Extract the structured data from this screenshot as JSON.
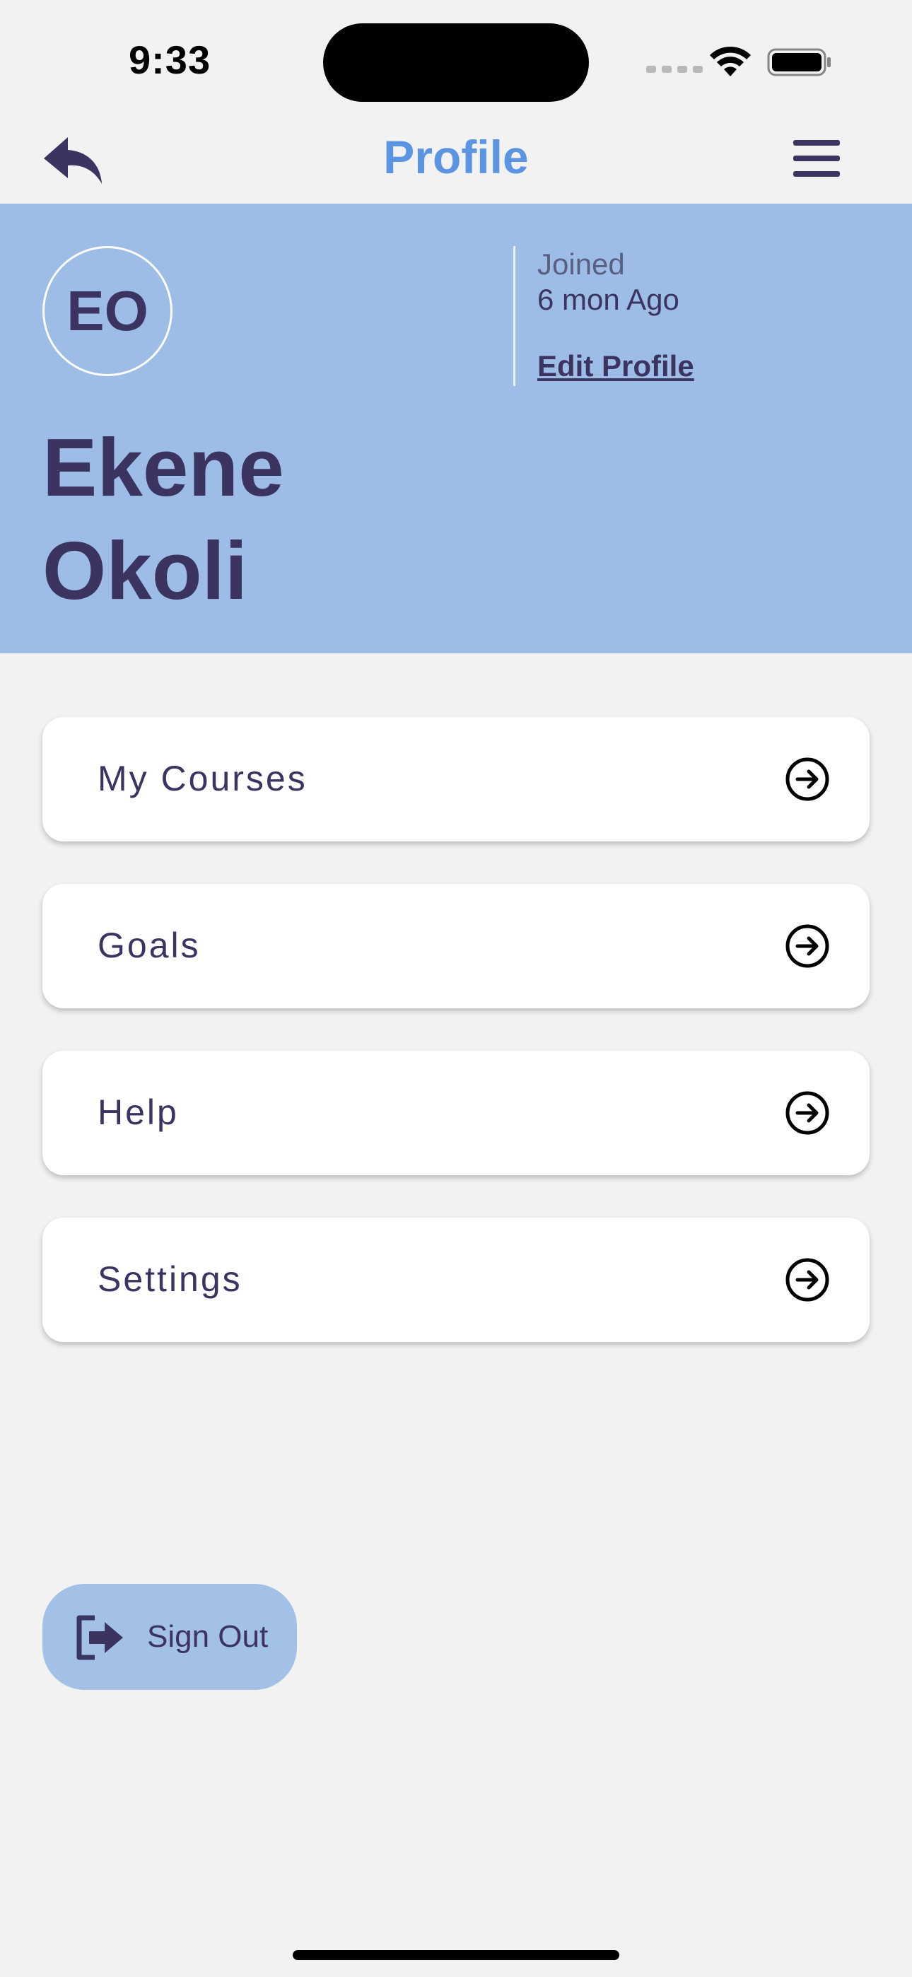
{
  "status_bar": {
    "time": "9:33"
  },
  "nav": {
    "title": "Profile",
    "back_icon": "reply-back-icon",
    "menu_icon": "hamburger-menu-icon"
  },
  "profile": {
    "initials": "EO",
    "first_name": "Ekene",
    "last_name": "Okoli",
    "joined_label": "Joined",
    "joined_value": "6 mon Ago",
    "edit_label": "Edit Profile"
  },
  "menu_items": [
    {
      "label": "My Courses"
    },
    {
      "label": "Goals"
    },
    {
      "label": "Help"
    },
    {
      "label": "Settings"
    }
  ],
  "sign_out": {
    "label": "Sign Out"
  },
  "colors": {
    "accent": "#5b94e0",
    "header_bg": "#9dbde6",
    "text": "#3b3461",
    "page_bg": "#f2f2f2",
    "signout_bg": "#a3c0e6"
  }
}
